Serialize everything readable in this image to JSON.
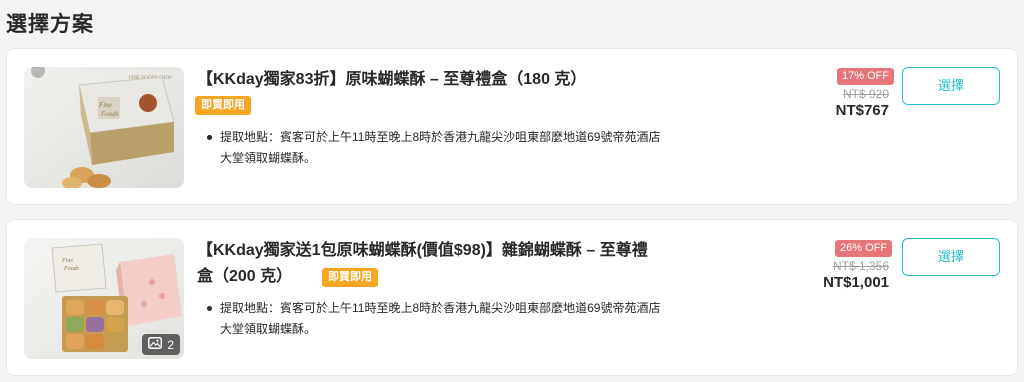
{
  "section": {
    "title": "選擇方案"
  },
  "packages": [
    {
      "title": "【KKday獨家83折】原味蝴蝶酥 – 至尊禮盒（180 克）",
      "badge": "即買即用",
      "description": "提取地點：賓客可於上午11時至晚上8時於香港九龍尖沙咀東部麼地道69號帝苑酒店大堂領取蝴蝶酥。",
      "discount": "17% OFF",
      "original_price": "NT$ 920",
      "price": "NT$767",
      "button": "選擇",
      "image_caption": "FINE FOODS SHOP"
    },
    {
      "title": "【KKday獨家送1包原味蝴蝶酥(價值$98)】雜錦蝴蝶酥 – 至尊禮盒（200 克）",
      "badge": "即買即用",
      "description": "提取地點：賓客可於上午11時至晚上8時於香港九龍尖沙咀東部麼地道69號帝苑酒店大堂領取蝴蝶酥。",
      "discount": "26% OFF",
      "original_price": "NT$ 1,356",
      "price": "NT$1,001",
      "button": "選擇",
      "gallery_count": "2"
    }
  ],
  "colors": {
    "accent": "#26bec9",
    "badge": "#f5a623",
    "discount": "#e8757a"
  }
}
